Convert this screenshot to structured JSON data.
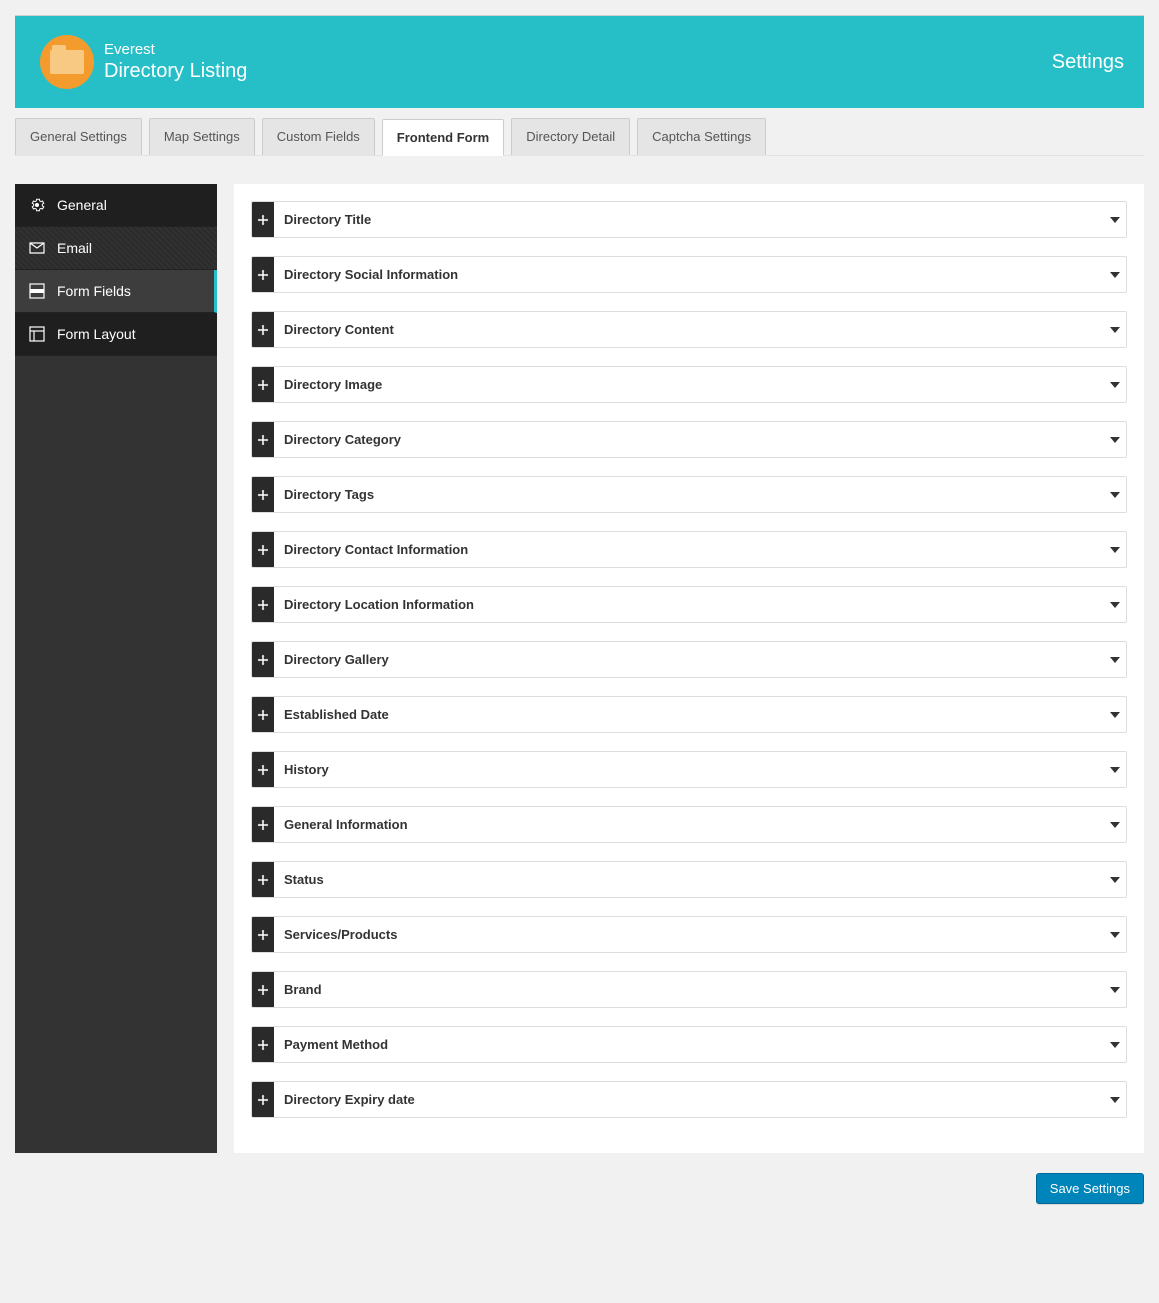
{
  "header": {
    "logo_line1": "Everest",
    "logo_line2": "Directory Listing",
    "title": "Settings"
  },
  "tabs": [
    {
      "label": "General Settings",
      "active": false
    },
    {
      "label": "Map Settings",
      "active": false
    },
    {
      "label": "Custom Fields",
      "active": false
    },
    {
      "label": "Frontend Form",
      "active": true
    },
    {
      "label": "Directory Detail",
      "active": false
    },
    {
      "label": "Captcha Settings",
      "active": false
    }
  ],
  "sidebar": {
    "items": [
      {
        "icon": "gear",
        "label": "General",
        "active": false,
        "textured": false
      },
      {
        "icon": "mail",
        "label": "Email",
        "active": false,
        "textured": true
      },
      {
        "icon": "form",
        "label": "Form Fields",
        "active": true,
        "textured": false
      },
      {
        "icon": "layout",
        "label": "Form Layout",
        "active": false,
        "textured": false
      }
    ]
  },
  "fields": [
    {
      "label": "Directory Title"
    },
    {
      "label": "Directory Social Information"
    },
    {
      "label": "Directory Content"
    },
    {
      "label": "Directory Image"
    },
    {
      "label": "Directory Category"
    },
    {
      "label": "Directory Tags"
    },
    {
      "label": "Directory Contact Information"
    },
    {
      "label": "Directory Location Information"
    },
    {
      "label": "Directory Gallery"
    },
    {
      "label": "Established Date"
    },
    {
      "label": "History"
    },
    {
      "label": "General Information"
    },
    {
      "label": "Status"
    },
    {
      "label": "Services/Products"
    },
    {
      "label": "Brand"
    },
    {
      "label": "Payment Method"
    },
    {
      "label": "Directory Expiry date"
    }
  ],
  "footer": {
    "save_label": "Save Settings"
  }
}
